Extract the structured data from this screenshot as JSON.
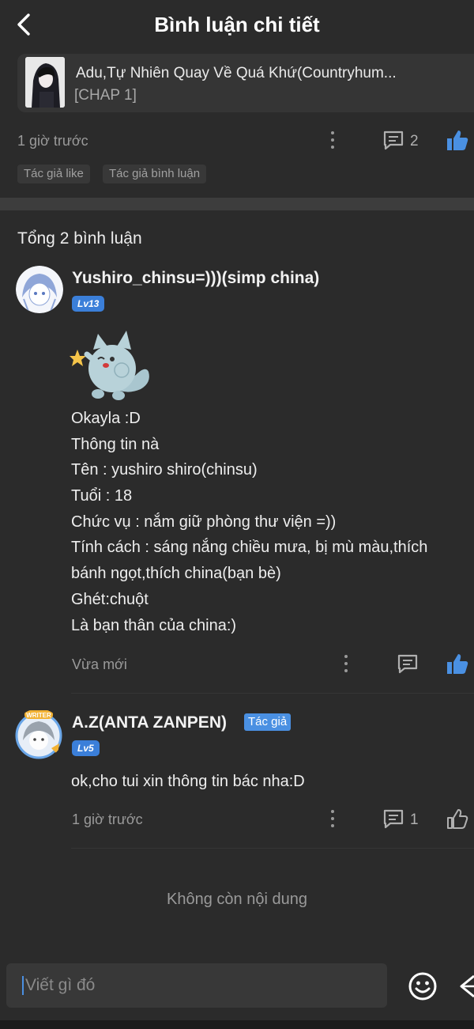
{
  "header": {
    "title": "Bình luận chi tiết"
  },
  "chapter": {
    "title": "Adu,Tự Nhiên Quay Về Quá Khứ(Countryhum...",
    "sub": "[CHAP 1]"
  },
  "post": {
    "time": "1 giờ trước",
    "comment_count": "2",
    "tags": [
      "Tác giả like",
      "Tác giả bình luận"
    ]
  },
  "total": "Tổng 2 bình luận",
  "comments": [
    {
      "username": "Yushiro_chinsu=)))(simp china)",
      "level": "Lv13",
      "lines": [
        "Okayla :D",
        "Thông tin nà",
        "Tên : yushiro shiro(chinsu)",
        "Tuổi : 18",
        "Chức vụ : nắm giữ phòng thư viện =))",
        "Tính cách : sáng nắng chiều mưa, bị mù màu,thích",
        "bánh ngọt,thích china(bạn bè)",
        "Ghét:chuột",
        "Là bạn thân của china:)"
      ],
      "time": "Vừa mới"
    },
    {
      "username": "A.Z(ANTA ZANPEN)",
      "badge": "Tác giả",
      "level": "Lv5",
      "avatar_text": "WRITER",
      "text": "ok,cho tui xin thông tin bác nha:D",
      "time": "1 giờ trước",
      "comment_count": "1"
    }
  ],
  "end_text": "Không còn nội dung",
  "input": {
    "placeholder": "Viết gì đó"
  },
  "colors": {
    "background": "#2b2b2b",
    "accent": "#4a90e2",
    "text": "#eeeeee",
    "muted": "#9a9a9a"
  },
  "icons": [
    "back-arrow-icon",
    "more-dots-icon",
    "comment-icon",
    "thumbs-up-icon",
    "emoji-icon",
    "send-icon"
  ]
}
